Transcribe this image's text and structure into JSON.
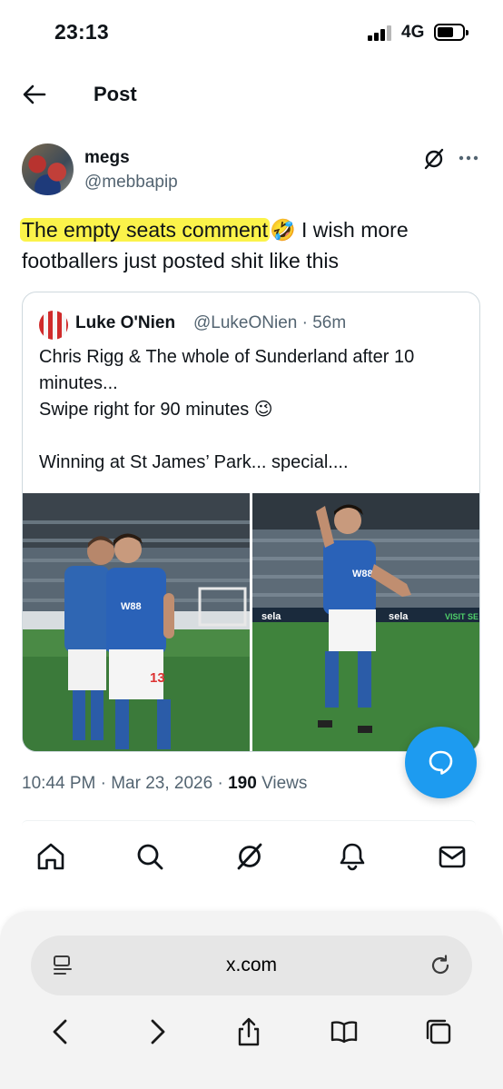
{
  "status_bar": {
    "time": "23:13",
    "network": "4G"
  },
  "header": {
    "title": "Post"
  },
  "post": {
    "author_name": "megs",
    "author_handle": "@mebbapip",
    "text_highlighted": "The empty seats comment",
    "text_emoji": "🤣",
    "text_rest": " I wish more footballers just posted shit like this",
    "highlight_color": "#fbf34a"
  },
  "quote": {
    "author_name": "Luke O'Nien",
    "author_handle": "@LukeONien",
    "time": "56m",
    "lines": [
      "Chris Rigg & The whole of Sunderland after 10 minutes...",
      "Swipe right for 90 minutes 😉",
      "",
      "Winning at St James’ Park... special...."
    ],
    "jersey_number": "13",
    "sponsor": "W88",
    "board_text": "sela",
    "board_text_2": "VISIT SE"
  },
  "meta": {
    "time": "10:44 PM",
    "date": "Mar 23, 2026",
    "views_count": "190",
    "views_label": "Views"
  },
  "bottom_nav": [
    "home-icon",
    "search-icon",
    "grok-icon",
    "notifications-icon",
    "messages-icon"
  ],
  "browser": {
    "url": "x.com"
  },
  "colors": {
    "accent": "#1d9bf0",
    "text": "#0f1419",
    "secondary": "#536471",
    "border": "#cfd9de"
  }
}
